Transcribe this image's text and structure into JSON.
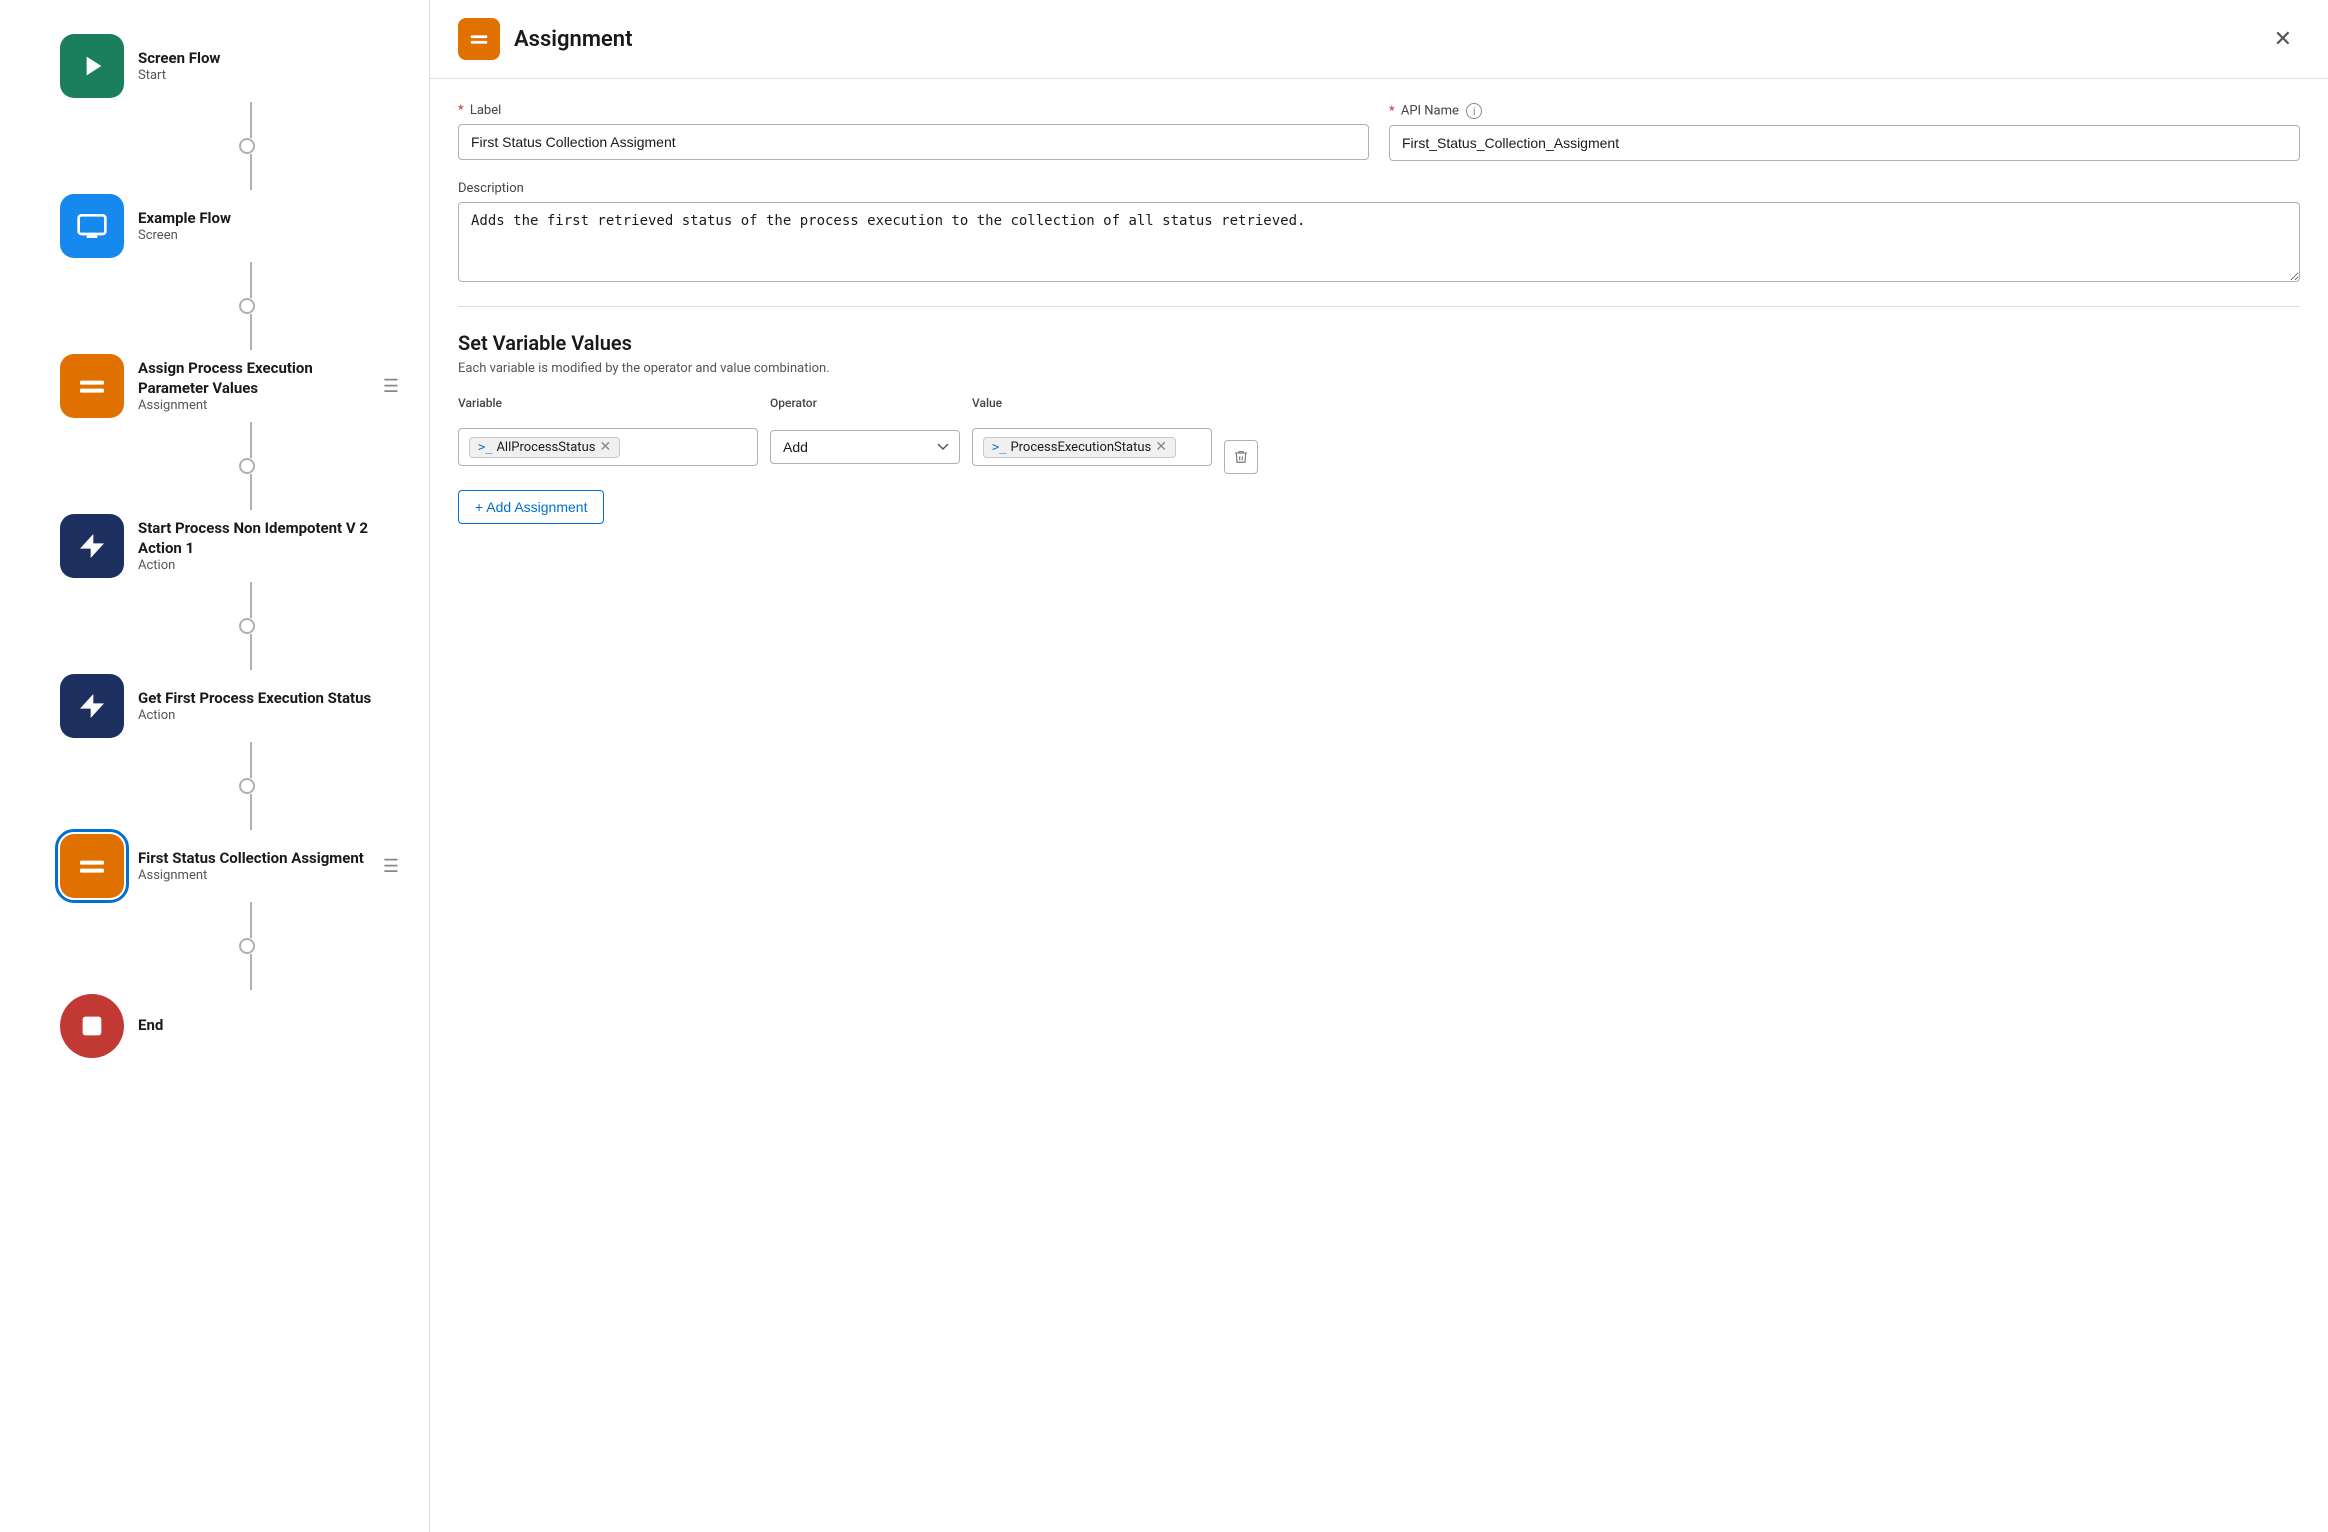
{
  "left_panel": {
    "nodes": [
      {
        "id": "screen-flow",
        "type": "start",
        "icon_type": "green",
        "title": "Screen Flow",
        "subtitle": "Start",
        "has_connector_below": true,
        "has_circle_below": true,
        "has_options": false,
        "selected": false
      },
      {
        "id": "example-flow",
        "type": "screen",
        "icon_type": "blue-light",
        "title": "Example Flow",
        "subtitle": "Screen",
        "has_connector_below": true,
        "has_circle_below": true,
        "has_options": false,
        "selected": false
      },
      {
        "id": "assign-process",
        "type": "assignment",
        "icon_type": "orange",
        "title": "Assign Process Execution Parameter Values",
        "subtitle": "Assignment",
        "has_connector_below": true,
        "has_circle_below": true,
        "has_options": true,
        "selected": false
      },
      {
        "id": "start-process",
        "type": "action",
        "icon_type": "dark-blue",
        "title": "Start Process Non Idempotent V 2 Action 1",
        "subtitle": "Action",
        "has_connector_below": true,
        "has_circle_below": true,
        "has_options": false,
        "selected": false
      },
      {
        "id": "get-first-process",
        "type": "action",
        "icon_type": "dark-blue",
        "title": "Get First Process Execution Status",
        "subtitle": "Action",
        "has_connector_below": true,
        "has_circle_below": true,
        "has_options": false,
        "selected": false
      },
      {
        "id": "first-status-collection",
        "type": "assignment",
        "icon_type": "orange",
        "title": "First Status Collection Assigment",
        "subtitle": "Assignment",
        "has_connector_below": true,
        "has_circle_below": true,
        "has_options": true,
        "selected": true
      },
      {
        "id": "end",
        "type": "end",
        "icon_type": "red",
        "title": "End",
        "subtitle": "",
        "has_connector_below": false,
        "has_circle_below": false,
        "has_options": false,
        "selected": false
      }
    ]
  },
  "right_panel": {
    "title": "Assignment",
    "label_field": {
      "label": "Label",
      "required": true,
      "value": "First Status Collection Assigment",
      "placeholder": "Label"
    },
    "api_name_field": {
      "label": "API Name",
      "required": true,
      "value": "First_Status_Collection_Assigment",
      "placeholder": "API Name",
      "has_info": true
    },
    "description_field": {
      "label": "Description",
      "value": "Adds the first retrieved status of the process execution to the collection of all status retrieved.",
      "placeholder": "Description"
    },
    "set_variable_section": {
      "title": "Set Variable Values",
      "description": "Each variable is modified by the operator and value combination.",
      "columns": {
        "variable": "Variable",
        "operator": "Operator",
        "value": "Value"
      },
      "rows": [
        {
          "variable_tag": "AllProcessStatus",
          "operator_value": "Add",
          "value_tag": "ProcessExecutionStatus"
        }
      ],
      "add_button_label": "+ Add Assignment"
    }
  }
}
